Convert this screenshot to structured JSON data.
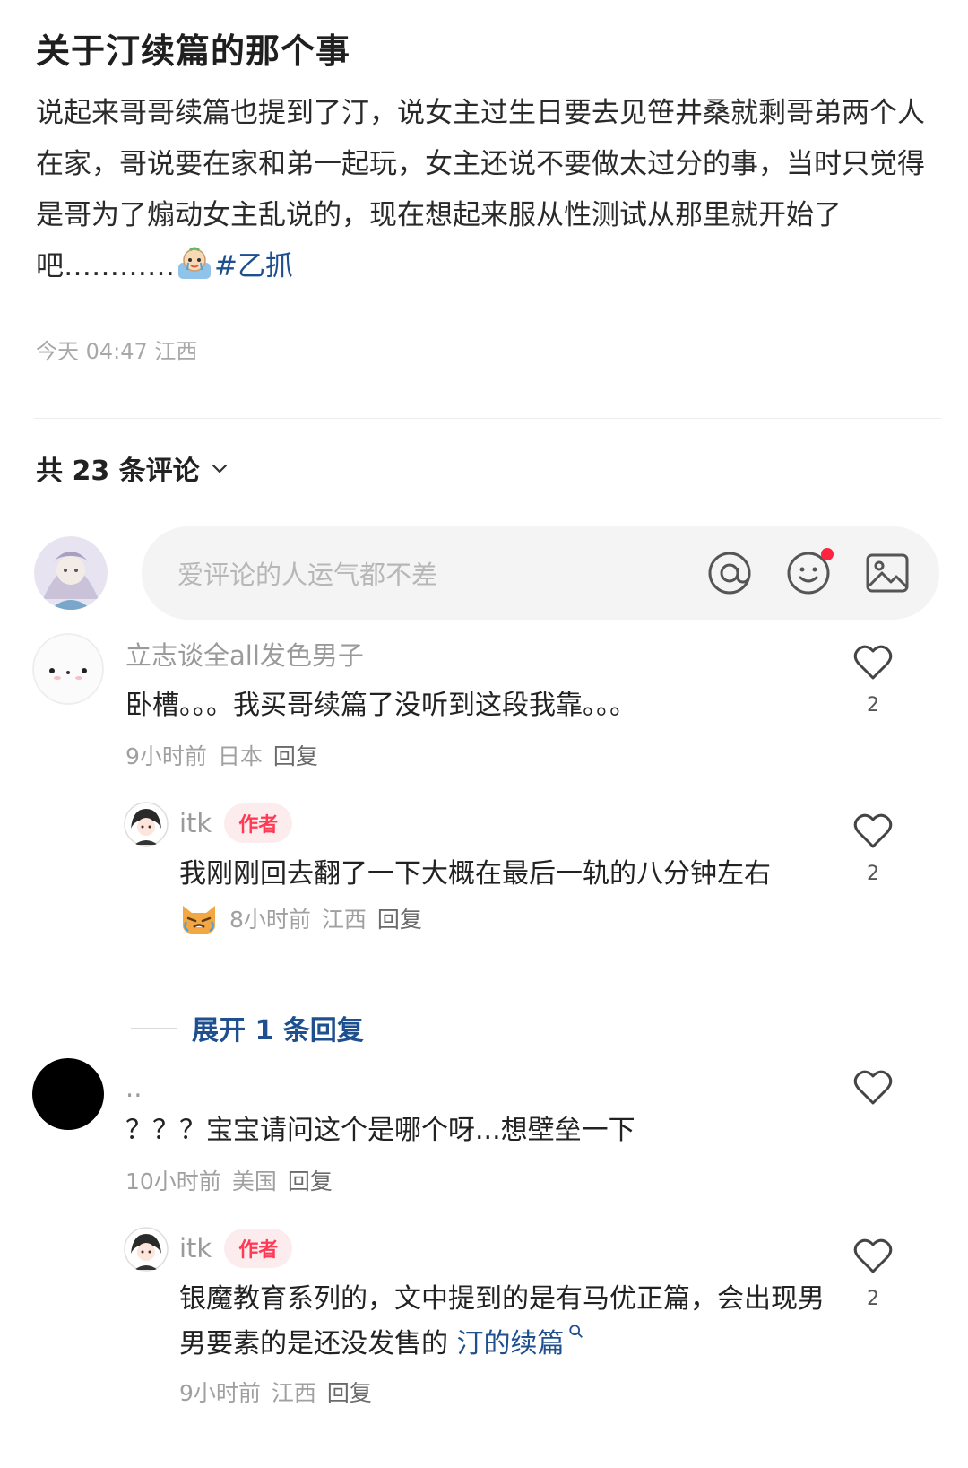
{
  "post": {
    "title": "关于汀续篇的那个事",
    "body": "说起来哥哥续篇也提到了汀，说女主过生日要去见笹井桑就剩哥弟两个人在家，哥说要在家和弟一起玩，女主还说不要做太过分的事，当时只觉得是哥为了煽动女主乱说的，现在想起来服从性测试从那里就开始了吧…………",
    "tag": "#乙抓",
    "meta": "今天 04:47 江西"
  },
  "comments_header": {
    "label": "共 23 条评论"
  },
  "composer": {
    "placeholder": "爱评论的人运气都不差"
  },
  "comments": [
    {
      "user": "立志谈全all发色男子",
      "text": "卧槽。。。我买哥续篇了没听到这段我靠。。。",
      "time": "9小时前",
      "location": "日本",
      "reply_label": "回复",
      "likes": "2",
      "replies": [
        {
          "user": "itk",
          "badge": "作者",
          "text": "我刚刚回去翻了一下大概在最后一轨的八分钟左右",
          "time": "8小时前",
          "location": "江西",
          "reply_label": "回复",
          "likes": "2"
        }
      ],
      "expand_label": "展开 1 条回复"
    },
    {
      "user": "..",
      "text": "？？？宝宝请问这个是哪个呀...想壁垒一下",
      "time": "10小时前",
      "location": "美国",
      "reply_label": "回复",
      "likes": "",
      "replies": [
        {
          "user": "itk",
          "badge": "作者",
          "text": "银魔教育系列的，文中提到的是有马优正篇，会出现男男要素的是还没发售的",
          "link": "汀的续篇",
          "time": "9小时前",
          "location": "江西",
          "reply_label": "回复",
          "likes": "2"
        }
      ]
    }
  ],
  "colors": {
    "link": "#1e4f8f",
    "accent": "#ff2442",
    "badge_text": "#ff3a55"
  },
  "icons": [
    "chevron-down-icon",
    "at-icon",
    "emoji-icon",
    "image-icon",
    "heart-icon",
    "search-icon"
  ]
}
